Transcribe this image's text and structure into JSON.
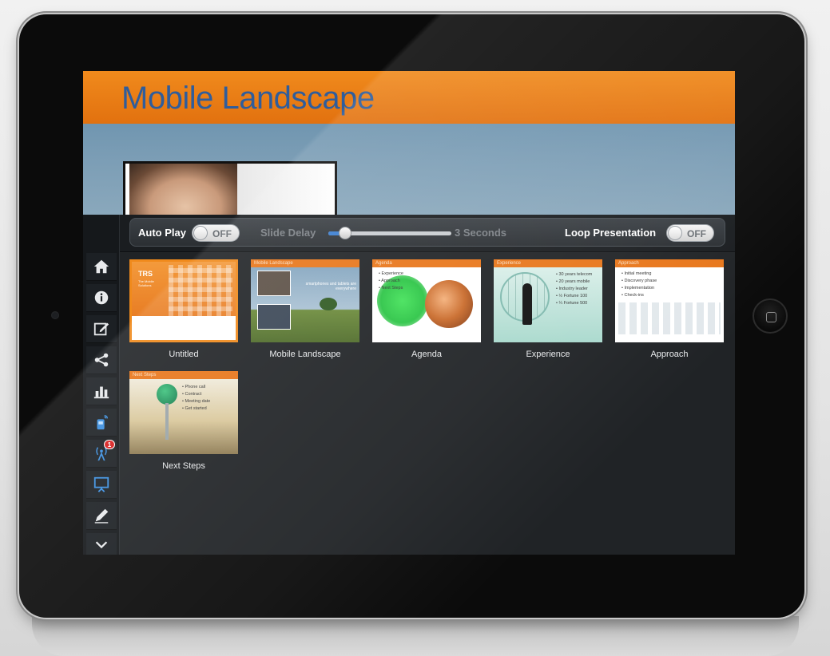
{
  "slide": {
    "title": "Mobile Landscape"
  },
  "toolbar": {
    "auto_play_label": "Auto Play",
    "auto_play_state": "OFF",
    "slide_delay_label": "Slide Delay",
    "slide_delay_value": "3 Seconds",
    "slide_delay_fraction": 0.1,
    "loop_label": "Loop Presentation",
    "loop_state": "OFF"
  },
  "sidebar": {
    "items": [
      {
        "icon": "home-icon"
      },
      {
        "icon": "info-icon"
      },
      {
        "icon": "edit-icon"
      },
      {
        "icon": "share-icon"
      },
      {
        "icon": "bar-chart-icon"
      },
      {
        "icon": "remote-icon"
      },
      {
        "icon": "broadcast-icon",
        "badge": "1"
      },
      {
        "icon": "presentation-icon"
      },
      {
        "icon": "pen-icon"
      },
      {
        "icon": "chevron-down-icon"
      }
    ]
  },
  "slides": [
    {
      "label": "Untitled",
      "selected": true,
      "logo": "TRS",
      "logo_sub": "The Mobile Solutions"
    },
    {
      "label": "Mobile Landscape",
      "header": "Mobile Landscape",
      "caption": "smartphones and tablets are everywhere"
    },
    {
      "label": "Agenda",
      "header": "Agenda",
      "bullets": [
        "Experience",
        "Approach",
        "Next Steps"
      ]
    },
    {
      "label": "Experience",
      "header": "Experience",
      "bullets": [
        "30 years telecom",
        "20 years mobile",
        "Industry leader",
        "½ Fortune 100",
        "¼ Fortune 500"
      ]
    },
    {
      "label": "Approach",
      "header": "Approach",
      "bullets": [
        "Initial meeting",
        "Discovery phase",
        "Implementation",
        "Check-ins"
      ]
    },
    {
      "label": "Next Steps",
      "header": "Next Steps",
      "bullets": [
        "Phone call",
        "Contract",
        "Meeting date",
        "Get started"
      ]
    }
  ],
  "colors": {
    "accent": "#E8761A",
    "title_blue": "#2F5D9C",
    "slider_blue": "#3B7FD1"
  }
}
